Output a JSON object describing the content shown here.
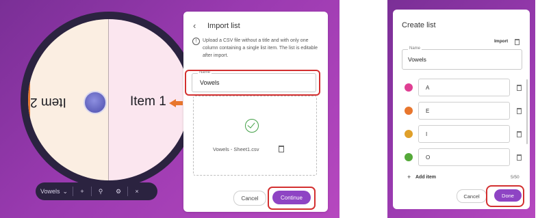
{
  "wheel": {
    "item1_label": "Item 1",
    "item2_label": "Item 2",
    "colors": {
      "orange": "#e8762d",
      "pink": "#df57a5",
      "hub": "#5b5cbd"
    }
  },
  "toolbar": {
    "list_name": "Vowels",
    "chevron_glyph": "⌄",
    "add_glyph": "+",
    "tool_glyph": "⚲",
    "settings_glyph": "⚙",
    "close_glyph": "×"
  },
  "import_panel": {
    "back_glyph": "‹",
    "title": "Import list",
    "info_glyph": "!",
    "description": "Upload a CSV file without a title and with only one column containing a single list item. The list is editable after import.",
    "name_label": "Name",
    "name_value": "Vowels",
    "file_name": "Vowels - Sheet1.csv",
    "cancel_label": "Cancel",
    "continue_label": "Continue"
  },
  "create_panel": {
    "title": "Create list",
    "import_label": "Import",
    "name_label": "Name",
    "name_value": "Vowels",
    "items": [
      {
        "value": "A",
        "color": "#df3f93"
      },
      {
        "value": "E",
        "color": "#e8762d"
      },
      {
        "value": "I",
        "color": "#e0a02a"
      },
      {
        "value": "O",
        "color": "#55a93a"
      }
    ],
    "add_label": "Add item",
    "count": "5/50",
    "cancel_label": "Cancel",
    "done_label": "Done"
  },
  "highlight_color": "#d32f2f",
  "accent_color": "#8e44c4"
}
